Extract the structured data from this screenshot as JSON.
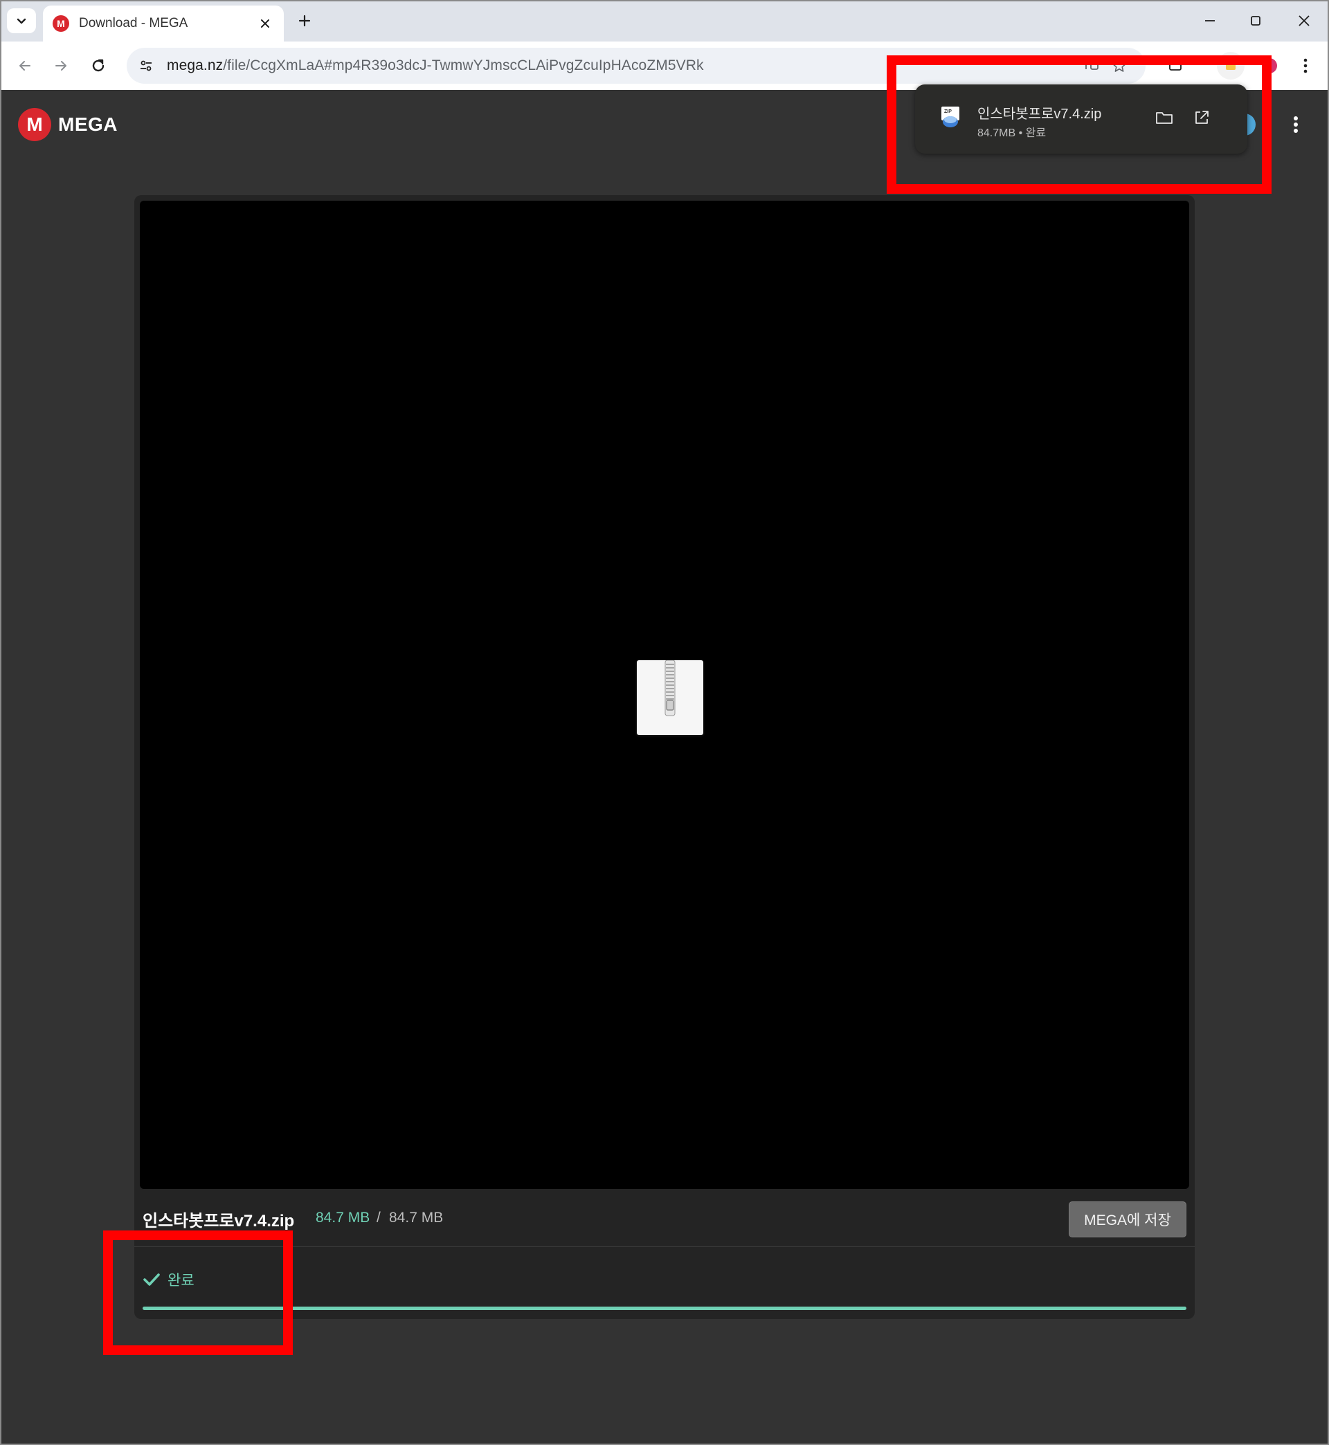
{
  "browser": {
    "tab": {
      "title": "Download - MEGA",
      "favicon_letter": "M"
    },
    "url": {
      "host": "mega.nz",
      "path": "/file/CcgXmLaA#mp4R39o3dcJ-TwmwYJmscCLAiPvgZcuIpHAcoZM5VRk"
    },
    "icons": {
      "tab_search": "chevron-down-icon",
      "tab_close": "close-icon",
      "new_tab": "plus-icon",
      "minimize": "minimize-icon",
      "maximize": "maximize-icon",
      "close_window": "close-icon",
      "back": "arrow-left-icon",
      "forward": "arrow-right-icon",
      "reload": "reload-icon",
      "site_info": "tune-icon",
      "translate": "translate-icon",
      "bookmark": "star-icon",
      "menu": "kebab-icon"
    }
  },
  "mega": {
    "logo_letter": "M",
    "logo_text": "MEGA",
    "file": {
      "name": "인스타봇프로v7.4.zip",
      "downloaded": "84.7 MB",
      "separator": "/",
      "total": "84.7 MB",
      "save_label": "MEGA에 저장"
    },
    "status": {
      "text": "완료",
      "progress_percent": 100
    }
  },
  "download_bubble": {
    "file_name": "인스타봇프로v7.4.zip",
    "file_size": "84.7MB",
    "bullet": "•",
    "status": "완료",
    "file_icon_label": "ZIP"
  },
  "colors": {
    "mega_red": "#d9272e",
    "accent_teal": "#6fd0b4",
    "annotation_red": "#ff0000",
    "page_bg": "#333333"
  }
}
